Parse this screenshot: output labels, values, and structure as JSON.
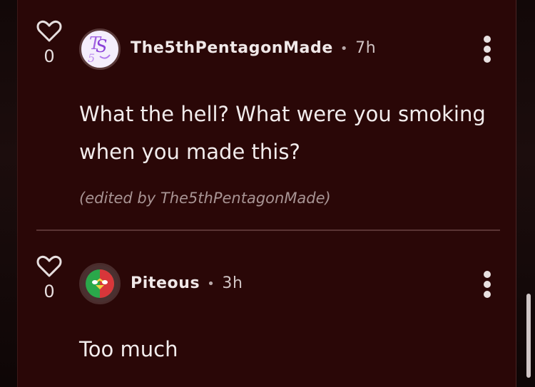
{
  "comments": [
    {
      "vote_count": "0",
      "avatar_icon": "ts-monogram-avatar",
      "username": "The5thPentagonMade",
      "separator": "•",
      "time": "7h",
      "text": "What the hell? What were you smoking when you made this?",
      "edited_note": "(edited by The5thPentagonMade)"
    },
    {
      "vote_count": "0",
      "avatar_icon": "countryball-avatar",
      "username": "Piteous",
      "separator": "•",
      "time": "3h",
      "text": "Too much"
    }
  ],
  "colors": {
    "panel_bg": "#2a0707",
    "page_bg": "#0d0606",
    "text": "#f2ecec",
    "muted_text": "#a89494",
    "divider": "#5a3434"
  }
}
